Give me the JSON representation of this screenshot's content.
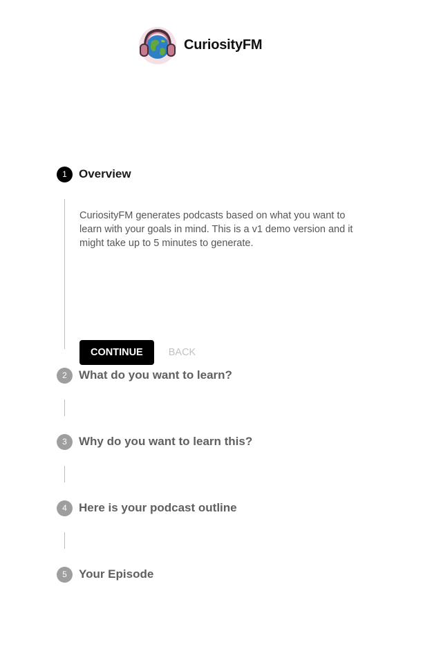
{
  "brand": {
    "name": "CuriosityFM",
    "logo_icon": "globe-with-headphones-icon"
  },
  "stepper": {
    "steps": [
      {
        "number": "1",
        "title": "Overview",
        "active": true
      },
      {
        "number": "2",
        "title": "What do you want to learn?",
        "active": false
      },
      {
        "number": "3",
        "title": "Why do you want to learn this?",
        "active": false
      },
      {
        "number": "4",
        "title": "Here is your podcast outline",
        "active": false
      },
      {
        "number": "5",
        "title": "Your Episode",
        "active": false
      }
    ],
    "overview": {
      "description": "CuriosityFM generates podcasts based on what you want to learn with your goals in mind. This is a v1 demo version and it might take up to 5 minutes to generate.",
      "continue_label": "CONTINUE",
      "back_label": "BACK"
    }
  },
  "colors": {
    "active_step": "#000000",
    "inactive_step": "#9e9e9e",
    "primary_button": "#000000",
    "disabled_text": "#c2c2c2"
  }
}
